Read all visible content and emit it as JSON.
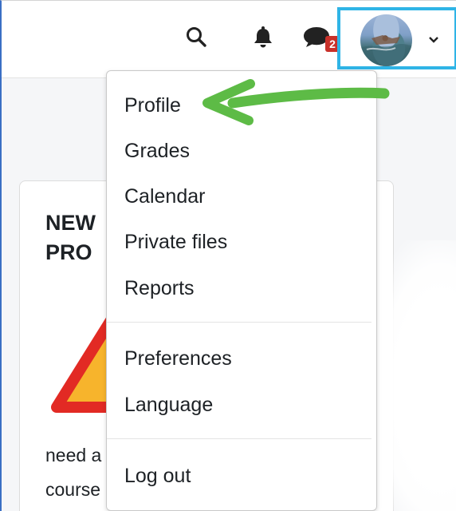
{
  "navbar": {
    "search_icon": "search-icon",
    "notification_icon": "bell-icon",
    "messages_icon": "chat-bubble-icon",
    "messages_count": "2",
    "user_avatar": "user-avatar",
    "dropdown_icon": "chevron-down-icon"
  },
  "card": {
    "title": "NEW\nPRO",
    "warning_icon": "warning-triangle-icon",
    "text_line_1": "need a",
    "text_line_2": "course"
  },
  "user_menu": {
    "items": [
      {
        "label": "Profile"
      },
      {
        "label": "Grades"
      },
      {
        "label": "Calendar"
      },
      {
        "label": "Private files"
      },
      {
        "label": "Reports"
      },
      {
        "label": "Preferences"
      },
      {
        "label": "Language"
      },
      {
        "label": "Log out"
      }
    ]
  },
  "annotation": {
    "arrow_color": "#5dbb46",
    "highlight_color": "#2fb4e6",
    "badge_color": "#c9312a"
  }
}
